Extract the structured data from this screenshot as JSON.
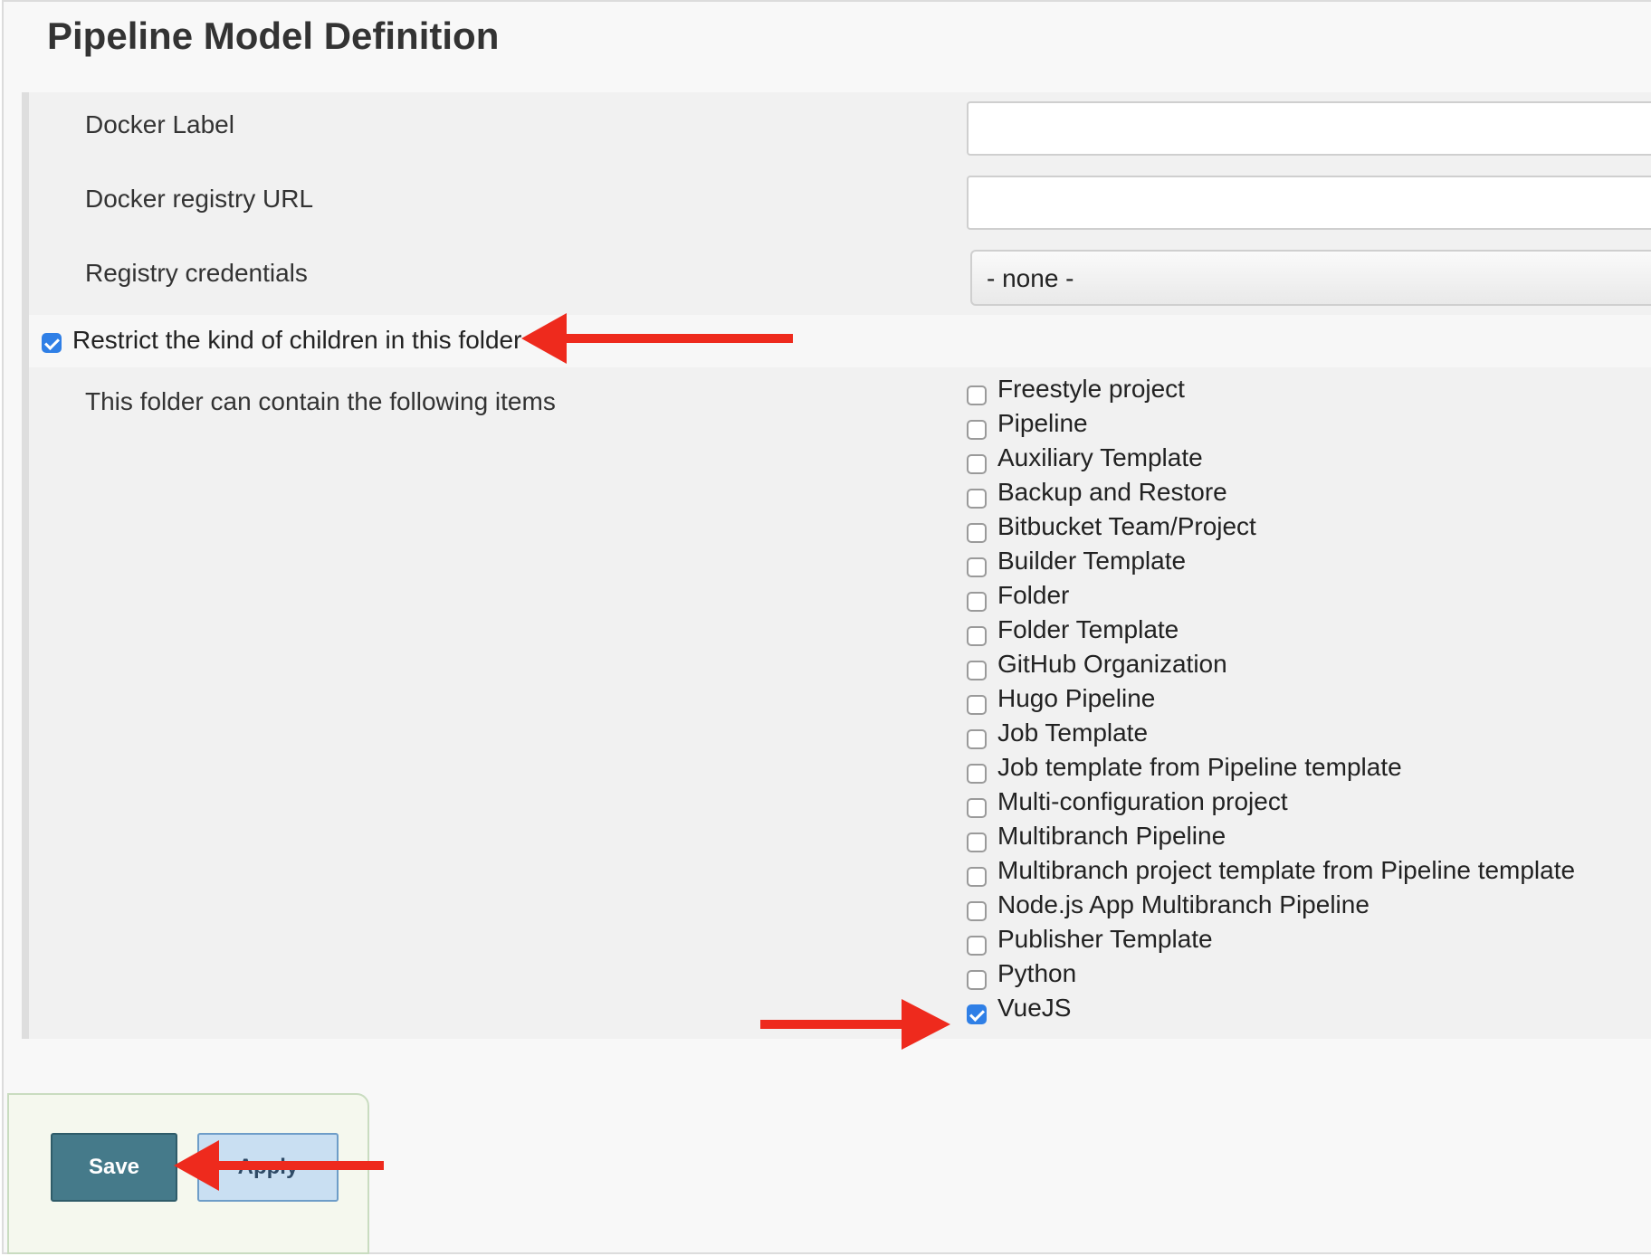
{
  "section": {
    "title": "Pipeline Model Definition"
  },
  "fields": {
    "docker_label": {
      "label": "Docker Label",
      "value": ""
    },
    "docker_registry_url": {
      "label": "Docker registry URL",
      "value": ""
    },
    "registry_credentials": {
      "label": "Registry credentials",
      "selected": "- none -"
    }
  },
  "restrict": {
    "label": "Restrict the kind of children in this folder",
    "checked": true
  },
  "allowed_items": {
    "label": "This folder can contain the following items",
    "items": [
      {
        "label": "Freestyle project",
        "checked": false
      },
      {
        "label": "Pipeline",
        "checked": false
      },
      {
        "label": "Auxiliary Template",
        "checked": false
      },
      {
        "label": "Backup and Restore",
        "checked": false
      },
      {
        "label": "Bitbucket Team/Project",
        "checked": false
      },
      {
        "label": "Builder Template",
        "checked": false
      },
      {
        "label": "Folder",
        "checked": false
      },
      {
        "label": "Folder Template",
        "checked": false
      },
      {
        "label": "GitHub Organization",
        "checked": false
      },
      {
        "label": "Hugo Pipeline",
        "checked": false
      },
      {
        "label": "Job Template",
        "checked": false
      },
      {
        "label": "Job template from Pipeline template",
        "checked": false
      },
      {
        "label": "Multi-configuration project",
        "checked": false
      },
      {
        "label": "Multibranch Pipeline",
        "checked": false
      },
      {
        "label": "Multibranch project template from Pipeline template",
        "checked": false
      },
      {
        "label": "Node.js App Multibranch Pipeline",
        "checked": false
      },
      {
        "label": "Publisher Template",
        "checked": false
      },
      {
        "label": "Python",
        "checked": false
      },
      {
        "label": "VueJS",
        "checked": true
      }
    ]
  },
  "buttons": {
    "save": "Save",
    "apply": "Apply"
  },
  "colors": {
    "annotation_arrow": "#ee2a1d",
    "checkbox_checked": "#2f7fe6",
    "save_button": "#457a8a"
  }
}
